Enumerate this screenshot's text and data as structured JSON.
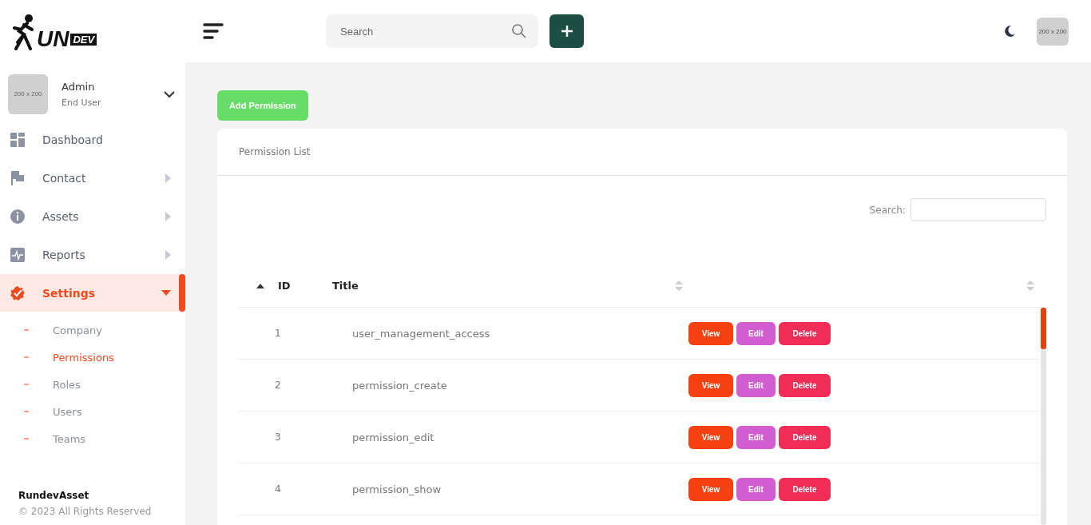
{
  "logo": {
    "text": "UN",
    "badge": "DEV"
  },
  "header": {
    "search": {
      "placeholder": "Search"
    },
    "avatar_text": "200 x 200"
  },
  "user": {
    "avatar_text": "200 x 200",
    "name": "Admin",
    "role": "End User"
  },
  "sidebar": {
    "items": [
      {
        "label": "Dashboard",
        "kind": "link",
        "selected": false
      },
      {
        "label": "Contact",
        "kind": "menu",
        "expanded": false,
        "selected": false
      },
      {
        "label": "Assets",
        "kind": "menu",
        "expanded": false,
        "selected": false
      },
      {
        "label": "Reports",
        "kind": "menu",
        "expanded": false,
        "selected": false
      },
      {
        "label": "Settings",
        "kind": "menu",
        "expanded": true,
        "selected": true,
        "children": [
          {
            "label": "Company",
            "selected": false
          },
          {
            "label": "Permissions",
            "selected": true
          },
          {
            "label": "Roles",
            "selected": false
          },
          {
            "label": "Users",
            "selected": false
          },
          {
            "label": "Teams",
            "selected": false
          }
        ]
      }
    ]
  },
  "footer": {
    "brand": "RundevAsset",
    "copyright": "© 2023 All Rights Reserved"
  },
  "add_button": "Add Permission",
  "card": {
    "title": "Permission List",
    "search_label": "Search:",
    "columns": [
      {
        "label": "ID",
        "sorted": true
      },
      {
        "label": "Title",
        "sorted": false
      },
      {
        "sorted": false
      }
    ],
    "rows": [
      {
        "id": "1",
        "title": "user_management_access",
        "actions": [
          "View",
          "Edit",
          "Delete"
        ]
      },
      {
        "id": "2",
        "title": "permission_create",
        "actions": [
          "View",
          "Edit",
          "Delete"
        ]
      },
      {
        "id": "3",
        "title": "permission_edit",
        "actions": [
          "View",
          "Edit",
          "Delete"
        ]
      },
      {
        "id": "4",
        "title": "permission_show",
        "actions": [
          "View",
          "Edit",
          "Delete"
        ]
      }
    ]
  }
}
